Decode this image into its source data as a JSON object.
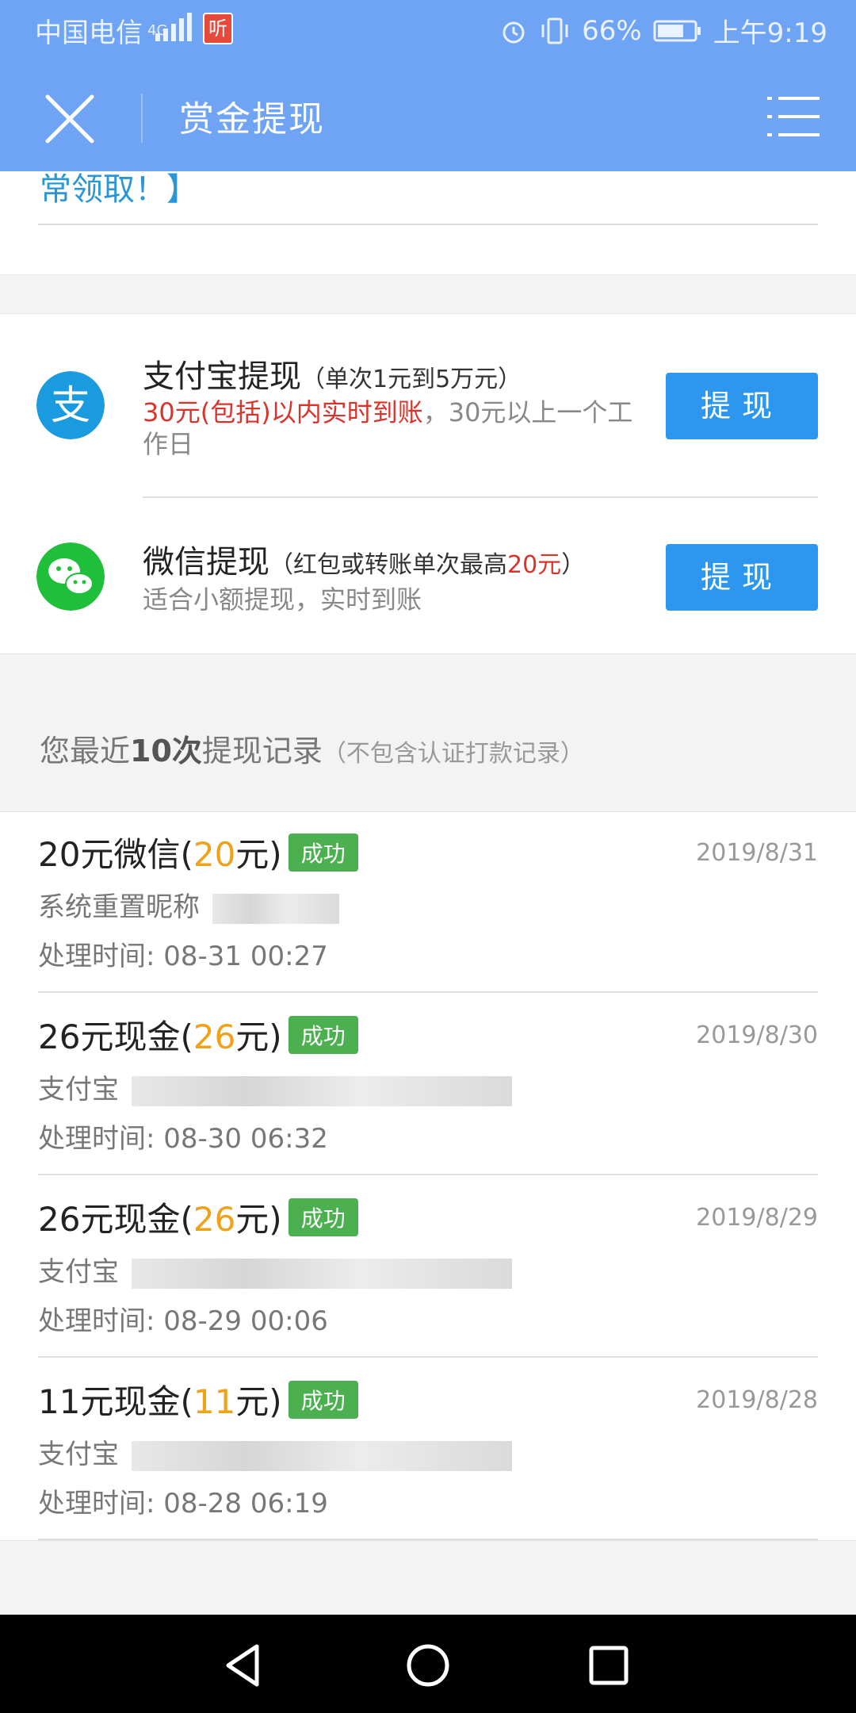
{
  "status": {
    "carrier": "中国电信",
    "network": "4G",
    "app_badge": "听",
    "battery": "66%",
    "time": "上午9:19"
  },
  "header": {
    "title": "赏金提现"
  },
  "notice": {
    "fragment": "常领取！】"
  },
  "options": [
    {
      "icon": "alipay-icon",
      "title": "支付宝提现",
      "note": "（单次1元到5万元）",
      "desc_highlight": "30元(包括)以内实时到账",
      "desc_rest": "，30元以上一个工作日",
      "button": "提现"
    },
    {
      "icon": "wechat-icon",
      "title": "微信提现",
      "note_pre": "（红包或转账单次最高",
      "note_highlight": "20元",
      "note_post": "）",
      "desc": "适合小额提现，实时到账",
      "button": "提现"
    }
  ],
  "records_heading": {
    "pre": "您最近",
    "count": "10次",
    "post": "提现记录",
    "sub": "（不包含认证打款记录）"
  },
  "records": [
    {
      "label_pre": "20元微信(",
      "amount": "20",
      "label_post": "元)",
      "status": "成功",
      "date": "2019/8/31",
      "account": "系统重置昵称",
      "time": "处理时间: 08-31 00:27"
    },
    {
      "label_pre": "26元现金(",
      "amount": "26",
      "label_post": "元)",
      "status": "成功",
      "date": "2019/8/30",
      "account": "支付宝",
      "time": "处理时间: 08-30 06:32"
    },
    {
      "label_pre": "26元现金(",
      "amount": "26",
      "label_post": "元)",
      "status": "成功",
      "date": "2019/8/29",
      "account": "支付宝",
      "time": "处理时间: 08-29 00:06"
    },
    {
      "label_pre": "11元现金(",
      "amount": "11",
      "label_post": "元)",
      "status": "成功",
      "date": "2019/8/28",
      "account": "支付宝",
      "time": "处理时间: 08-28 06:19"
    }
  ],
  "colors": {
    "header": "#6fa3f3",
    "button": "#2d96ee",
    "success": "#4cb050",
    "amount": "#f0a11a",
    "highlight": "#d9342b"
  }
}
